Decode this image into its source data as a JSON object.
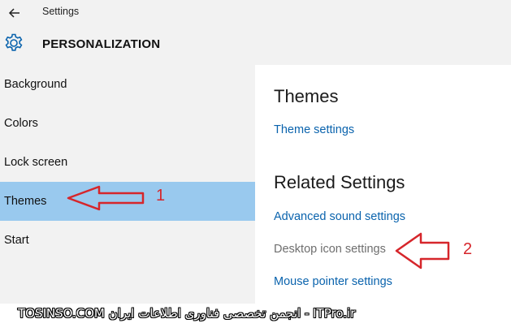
{
  "header": {
    "window_title": "Settings",
    "page_title": "PERSONALIZATION",
    "icons": {
      "back": "back-arrow-icon",
      "settings": "gear-icon"
    },
    "accent_color": "#0a63ad"
  },
  "sidebar": {
    "items": [
      {
        "label": "Background",
        "selected": false
      },
      {
        "label": "Colors",
        "selected": false
      },
      {
        "label": "Lock screen",
        "selected": false
      },
      {
        "label": "Themes",
        "selected": true
      },
      {
        "label": "Start",
        "selected": false
      }
    ],
    "selected_color": "#99c9ee"
  },
  "main": {
    "themes_heading": "Themes",
    "theme_settings_link": "Theme settings",
    "related_heading": "Related Settings",
    "related_links": [
      {
        "label": "Advanced sound settings",
        "enabled": true
      },
      {
        "label": "Desktop icon settings",
        "enabled": false
      },
      {
        "label": "Mouse pointer settings",
        "enabled": true
      }
    ]
  },
  "annotations": {
    "marker_1": "1",
    "marker_2": "2",
    "color": "#d6262b"
  },
  "watermark": "TOSINSO.COM انجمن تخصصی فناوری اطلاعات ایران - ITPro.ir"
}
